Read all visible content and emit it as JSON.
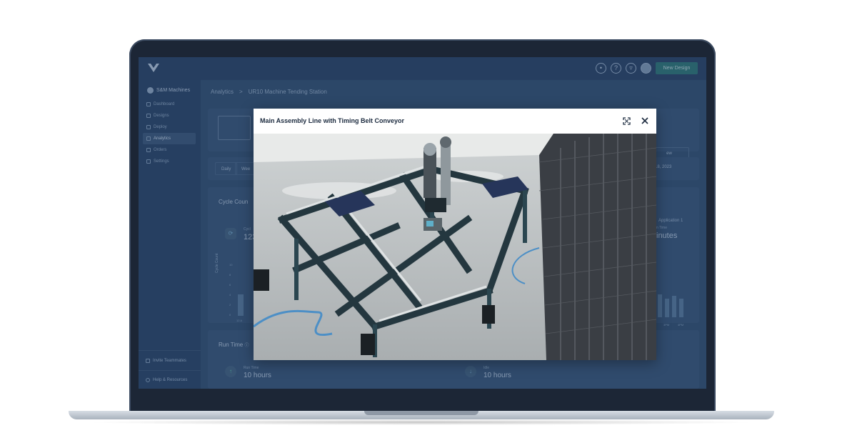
{
  "topbar": {
    "logo_icon": "v-logo-icon",
    "icons": [
      "bell-icon",
      "help-icon",
      "cart-icon",
      "avatar"
    ],
    "help_glyph": "?",
    "new_design_label": "New Design"
  },
  "sidebar": {
    "org_name": "S&M Machines",
    "items": [
      {
        "label": "Dashboard",
        "icon": "dashboard-icon",
        "active": false
      },
      {
        "label": "Designs",
        "icon": "designs-icon",
        "active": false
      },
      {
        "label": "Deploy",
        "icon": "deploy-icon",
        "active": false
      },
      {
        "label": "Analytics",
        "icon": "analytics-icon",
        "active": true
      },
      {
        "label": "Orders",
        "icon": "orders-icon",
        "active": false
      },
      {
        "label": "Settings",
        "icon": "settings-icon",
        "active": false
      }
    ],
    "invite_label": "Invite Teammates",
    "help_label": "Help & Resources"
  },
  "main": {
    "breadcrumb": {
      "root": "Analytics",
      "separator": ">",
      "current": "UR10 Machine Tending Station"
    },
    "preview_button": "ew",
    "tabs": [
      "Daily",
      "Wee"
    ],
    "date_label": "18, 2023",
    "cycle_count": {
      "title": "Cycle Coun",
      "stat_label": "Cycl",
      "stat_value": "123",
      "y_axis_label": "Cycle Count",
      "y_ticks": [
        "10",
        "8",
        "6",
        "4",
        "2",
        "0"
      ],
      "x_tick": "12 A"
    },
    "application_label": "Application 1",
    "run_time_right": {
      "label": "n Time",
      "value": "inutes",
      "x_ticks": [
        "3PM",
        "4PM"
      ]
    },
    "run_time": {
      "title": "Run Time",
      "info_glyph": "ⓘ",
      "items": [
        {
          "label": "Run Time",
          "value": "10 hours",
          "icon": "arrow-up-icon",
          "color": "#5fd3a6"
        },
        {
          "label": "Idle",
          "value": "10 hours",
          "icon": "arrow-down-icon",
          "color": "#7fb4d2"
        }
      ]
    }
  },
  "modal": {
    "title": "Main Assembly Line with Timing Belt Conveyor",
    "expand_icon": "expand-icon",
    "close_icon": "close-icon"
  },
  "colors": {
    "bezel": "#1c2636",
    "screen_bg": "#2f4766",
    "accent_teal": "#2f7a73",
    "modal_bg": "#ffffff"
  }
}
